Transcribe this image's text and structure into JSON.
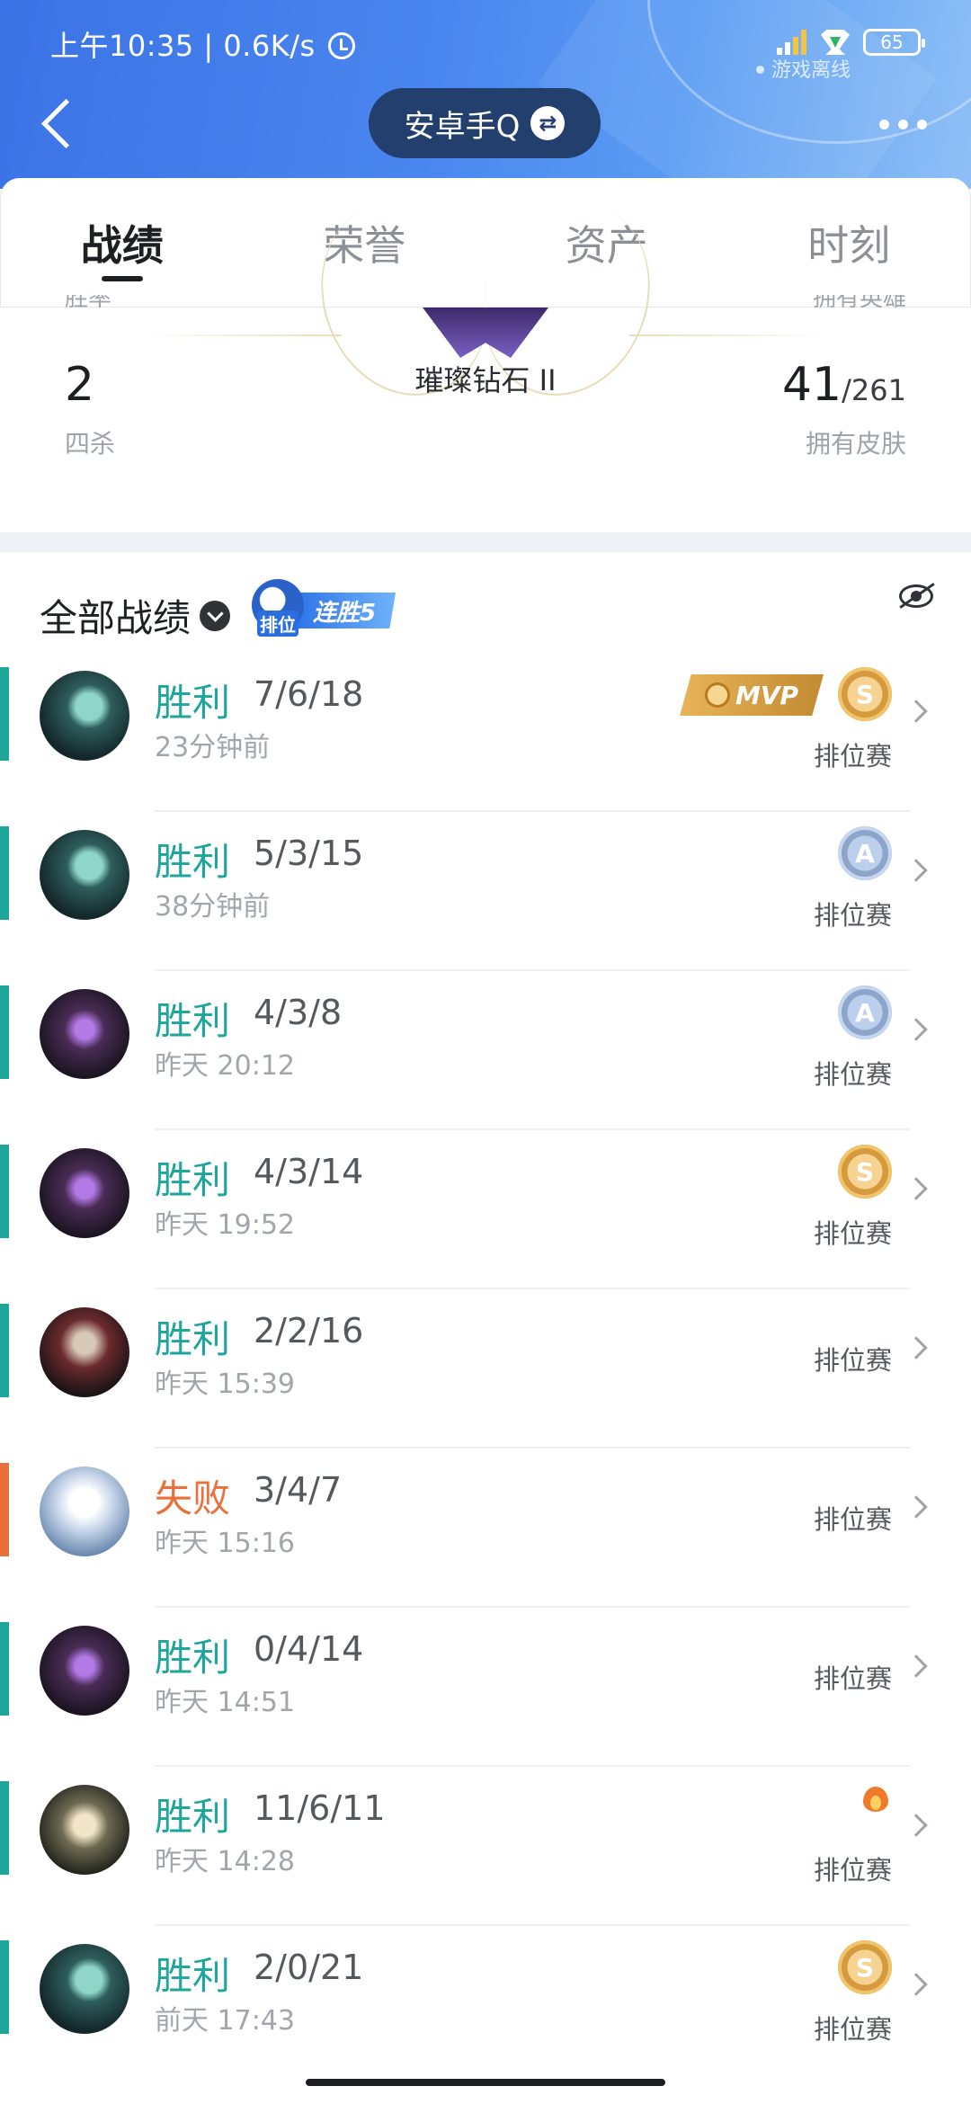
{
  "status_bar": {
    "time_speed": "上午10:35 | 0.6K/s",
    "battery": "65",
    "offline_status": "游戏离线"
  },
  "header": {
    "account_name": "安卓手Q",
    "icons": [
      "back-arrow-icon",
      "swap-icon",
      "more-icon"
    ]
  },
  "tabs": [
    {
      "label": "战绩",
      "active": true
    },
    {
      "label": "荣誉",
      "active": false
    },
    {
      "label": "资产",
      "active": false
    },
    {
      "label": "时刻",
      "active": false
    }
  ],
  "summary": {
    "win_rate_label": "胜率",
    "owned_heroes_label": "拥有英雄",
    "rank": "璀璨钻石 II",
    "quadra_kills": {
      "value": "2",
      "label": "四杀"
    },
    "skins": {
      "owned": "41",
      "total": "/261",
      "label": "拥有皮肤"
    }
  },
  "list_header": {
    "filter_label": "全部战绩",
    "streak_badge_small": "排位",
    "streak_badge": "连胜5"
  },
  "colors": {
    "win": "#1fa69a",
    "loss": "#e9703b",
    "header_blue": "#3b73e6"
  },
  "matches": [
    {
      "result": "胜利",
      "kda": "7/6/18",
      "time": "23分钟前",
      "mode": "排位赛",
      "outcome": "win",
      "badges": [
        "mvp",
        "s"
      ],
      "mvp_label": "MVP",
      "s_label": "S",
      "hero_avatar": "hero-green"
    },
    {
      "result": "胜利",
      "kda": "5/3/15",
      "time": "38分钟前",
      "mode": "排位赛",
      "outcome": "win",
      "badges": [
        "a"
      ],
      "a_label": "A",
      "hero_avatar": "hero-green"
    },
    {
      "result": "胜利",
      "kda": "4/3/8",
      "time": "昨天 20:12",
      "mode": "排位赛",
      "outcome": "win",
      "badges": [
        "a"
      ],
      "a_label": "A",
      "hero_avatar": "hero-purple"
    },
    {
      "result": "胜利",
      "kda": "4/3/14",
      "time": "昨天 19:52",
      "mode": "排位赛",
      "outcome": "win",
      "badges": [
        "s"
      ],
      "s_label": "S",
      "hero_avatar": "hero-purple"
    },
    {
      "result": "胜利",
      "kda": "2/2/16",
      "time": "昨天 15:39",
      "mode": "排位赛",
      "outcome": "win",
      "badges": [],
      "hero_avatar": "hero-red"
    },
    {
      "result": "失败",
      "kda": "3/4/7",
      "time": "昨天 15:16",
      "mode": "排位赛",
      "outcome": "loss",
      "badges": [],
      "hero_avatar": "hero-white"
    },
    {
      "result": "胜利",
      "kda": "0/4/14",
      "time": "昨天 14:51",
      "mode": "排位赛",
      "outcome": "win",
      "badges": [],
      "hero_avatar": "hero-purple"
    },
    {
      "result": "胜利",
      "kda": "11/6/11",
      "time": "昨天 14:28",
      "mode": "排位赛",
      "outcome": "win",
      "badges": [
        "fire"
      ],
      "hero_avatar": "hero-gold"
    },
    {
      "result": "胜利",
      "kda": "2/0/21",
      "time": "前天 17:43",
      "mode": "排位赛",
      "outcome": "win",
      "badges": [
        "s"
      ],
      "s_label": "S",
      "hero_avatar": "hero-green"
    }
  ]
}
